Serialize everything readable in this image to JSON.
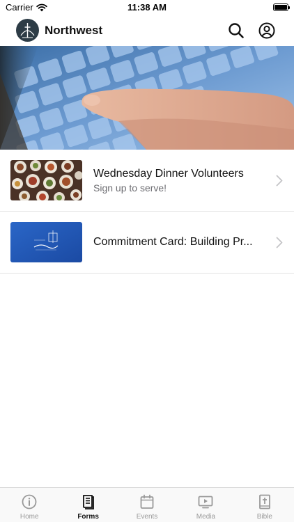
{
  "status_bar": {
    "carrier": "Carrier",
    "time": "11:38 AM",
    "battery_level": 1.0
  },
  "header": {
    "title": "Northwest",
    "search_icon": "search-icon",
    "account_icon": "account-icon"
  },
  "list": {
    "items": [
      {
        "title": "Wednesday Dinner Volunteers",
        "subtitle": "Sign up to serve!"
      },
      {
        "title": "Commitment Card: Building Pr...",
        "subtitle": ""
      }
    ]
  },
  "tabs": [
    {
      "label": "Home",
      "icon": "info-icon",
      "active": false
    },
    {
      "label": "Forms",
      "icon": "forms-icon",
      "active": true
    },
    {
      "label": "Events",
      "icon": "calendar-icon",
      "active": false
    },
    {
      "label": "Media",
      "icon": "media-icon",
      "active": false
    },
    {
      "label": "Bible",
      "icon": "bible-icon",
      "active": false
    }
  ],
  "colors": {
    "active_tab": "#111111",
    "inactive_tab": "#999999",
    "subtitle": "#6d6d72",
    "logo_bg": "#2d3c46"
  }
}
